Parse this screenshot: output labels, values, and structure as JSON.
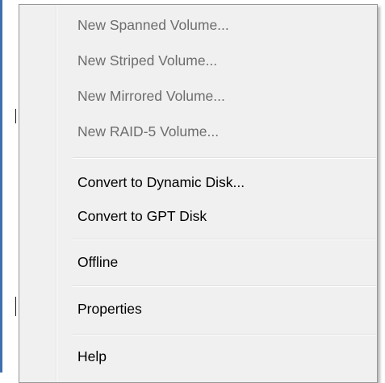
{
  "menu": {
    "items": [
      {
        "label": "New Spanned Volume...",
        "enabled": false
      },
      {
        "label": "New Striped Volume...",
        "enabled": false
      },
      {
        "label": "New Mirrored Volume...",
        "enabled": false
      },
      {
        "label": "New RAID-5 Volume...",
        "enabled": false
      },
      {
        "label": "Convert to Dynamic Disk...",
        "enabled": true
      },
      {
        "label": "Convert to GPT Disk",
        "enabled": true
      },
      {
        "label": "Offline",
        "enabled": true
      },
      {
        "label": "Properties",
        "enabled": true
      },
      {
        "label": "Help",
        "enabled": true
      }
    ]
  },
  "colors": {
    "menu_background": "#f0f0f0",
    "menu_border": "#979797",
    "disabled_text": "#6d6d6d",
    "enabled_text": "#000000",
    "window_edge": "#3f6fae"
  }
}
